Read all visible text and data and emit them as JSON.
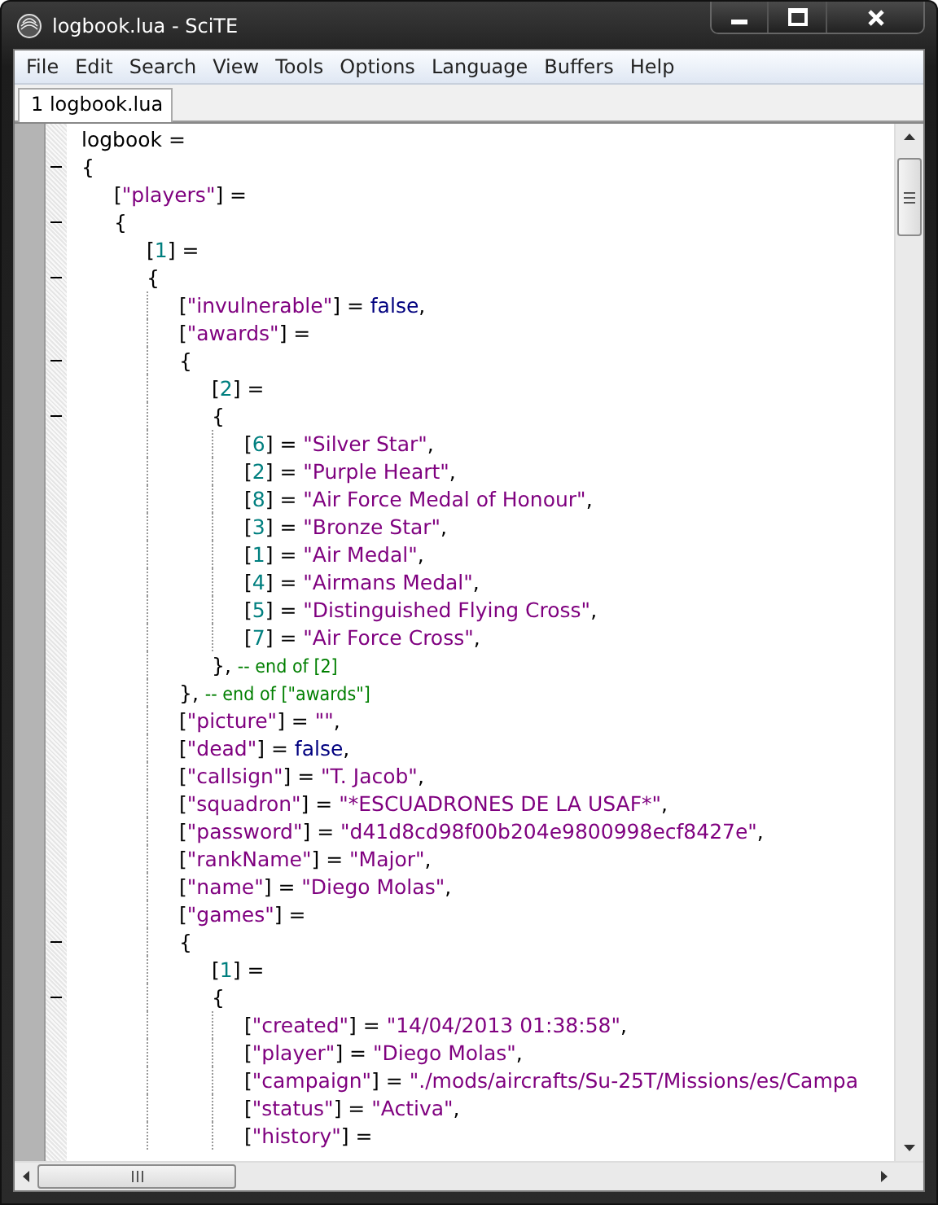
{
  "window": {
    "title": "logbook.lua - SciTE"
  },
  "menu": [
    "File",
    "Edit",
    "Search",
    "View",
    "Tools",
    "Options",
    "Language",
    "Buffers",
    "Help"
  ],
  "tabs": [
    {
      "label": "1 logbook.lua",
      "selected": true
    }
  ],
  "editor": {
    "lines": [
      {
        "tokens": [
          {
            "kind": "op",
            "text": "logbook ="
          }
        ]
      },
      {
        "tokens": [
          {
            "kind": "op",
            "text": "{"
          }
        ],
        "expanded": true,
        "children": [
          {
            "tokens": [
              {
                "kind": "op",
                "text": "["
              },
              {
                "kind": "str",
                "text": "\"players\""
              },
              {
                "kind": "op",
                "text": "] ="
              }
            ]
          },
          {
            "tokens": [
              {
                "kind": "op",
                "text": "{"
              }
            ],
            "expanded": true,
            "children": [
              {
                "tokens": [
                  {
                    "kind": "op",
                    "text": "["
                  },
                  {
                    "kind": "num",
                    "text": "1"
                  },
                  {
                    "kind": "op",
                    "text": "] ="
                  }
                ]
              },
              {
                "tokens": [
                  {
                    "kind": "op",
                    "text": "{"
                  }
                ],
                "expanded": true,
                "children": [
                  {
                    "tokens": [
                      {
                        "kind": "op",
                        "text": "["
                      },
                      {
                        "kind": "str",
                        "text": "\"invulnerable\""
                      },
                      {
                        "kind": "op",
                        "text": "] = "
                      },
                      {
                        "kind": "kw",
                        "text": "false"
                      },
                      {
                        "kind": "op",
                        "text": ","
                      }
                    ]
                  },
                  {
                    "tokens": [
                      {
                        "kind": "op",
                        "text": "["
                      },
                      {
                        "kind": "str",
                        "text": "\"awards\""
                      },
                      {
                        "kind": "op",
                        "text": "] ="
                      }
                    ]
                  },
                  {
                    "tokens": [
                      {
                        "kind": "op",
                        "text": "{"
                      }
                    ],
                    "expanded": true,
                    "children": [
                      {
                        "tokens": [
                          {
                            "kind": "op",
                            "text": "["
                          },
                          {
                            "kind": "num",
                            "text": "2"
                          },
                          {
                            "kind": "op",
                            "text": "] ="
                          }
                        ]
                      },
                      {
                        "tokens": [
                          {
                            "kind": "op",
                            "text": "{"
                          }
                        ],
                        "expanded": true,
                        "children": [
                          {
                            "tokens": [
                              {
                                "kind": "op",
                                "text": "["
                              },
                              {
                                "kind": "num",
                                "text": "6"
                              },
                              {
                                "kind": "op",
                                "text": "] = "
                              },
                              {
                                "kind": "str",
                                "text": "\"Silver Star\""
                              },
                              {
                                "kind": "op",
                                "text": ","
                              }
                            ]
                          },
                          {
                            "tokens": [
                              {
                                "kind": "op",
                                "text": "["
                              },
                              {
                                "kind": "num",
                                "text": "2"
                              },
                              {
                                "kind": "op",
                                "text": "] = "
                              },
                              {
                                "kind": "str",
                                "text": "\"Purple Heart\""
                              },
                              {
                                "kind": "op",
                                "text": ","
                              }
                            ]
                          },
                          {
                            "tokens": [
                              {
                                "kind": "op",
                                "text": "["
                              },
                              {
                                "kind": "num",
                                "text": "8"
                              },
                              {
                                "kind": "op",
                                "text": "] = "
                              },
                              {
                                "kind": "str",
                                "text": "\"Air Force Medal of Honour\""
                              },
                              {
                                "kind": "op",
                                "text": ","
                              }
                            ]
                          },
                          {
                            "tokens": [
                              {
                                "kind": "op",
                                "text": "["
                              },
                              {
                                "kind": "num",
                                "text": "3"
                              },
                              {
                                "kind": "op",
                                "text": "] = "
                              },
                              {
                                "kind": "str",
                                "text": "\"Bronze Star\""
                              },
                              {
                                "kind": "op",
                                "text": ","
                              }
                            ]
                          },
                          {
                            "tokens": [
                              {
                                "kind": "op",
                                "text": "["
                              },
                              {
                                "kind": "num",
                                "text": "1"
                              },
                              {
                                "kind": "op",
                                "text": "] = "
                              },
                              {
                                "kind": "str",
                                "text": "\"Air Medal\""
                              },
                              {
                                "kind": "op",
                                "text": ","
                              }
                            ]
                          },
                          {
                            "tokens": [
                              {
                                "kind": "op",
                                "text": "["
                              },
                              {
                                "kind": "num",
                                "text": "4"
                              },
                              {
                                "kind": "op",
                                "text": "] = "
                              },
                              {
                                "kind": "str",
                                "text": "\"Airmans Medal\""
                              },
                              {
                                "kind": "op",
                                "text": ","
                              }
                            ]
                          },
                          {
                            "tokens": [
                              {
                                "kind": "op",
                                "text": "["
                              },
                              {
                                "kind": "num",
                                "text": "5"
                              },
                              {
                                "kind": "op",
                                "text": "] = "
                              },
                              {
                                "kind": "str",
                                "text": "\"Distinguished Flying Cross\""
                              },
                              {
                                "kind": "op",
                                "text": ","
                              }
                            ]
                          },
                          {
                            "tokens": [
                              {
                                "kind": "op",
                                "text": "["
                              },
                              {
                                "kind": "num",
                                "text": "7"
                              },
                              {
                                "kind": "op",
                                "text": "] = "
                              },
                              {
                                "kind": "str",
                                "text": "\"Air Force Cross\""
                              },
                              {
                                "kind": "op",
                                "text": ","
                              }
                            ]
                          }
                        ]
                      },
                      {
                        "tokens": [
                          {
                            "kind": "op",
                            "text": "}, "
                          },
                          {
                            "kind": "cmt",
                            "text": "-- end of [2]"
                          }
                        ]
                      }
                    ]
                  },
                  {
                    "tokens": [
                      {
                        "kind": "op",
                        "text": "}, "
                      },
                      {
                        "kind": "cmt",
                        "text": "-- end of [\"awards\"]"
                      }
                    ]
                  },
                  {
                    "tokens": [
                      {
                        "kind": "op",
                        "text": "["
                      },
                      {
                        "kind": "str",
                        "text": "\"picture\""
                      },
                      {
                        "kind": "op",
                        "text": "] = "
                      },
                      {
                        "kind": "str",
                        "text": "\"\""
                      },
                      {
                        "kind": "op",
                        "text": ","
                      }
                    ]
                  },
                  {
                    "tokens": [
                      {
                        "kind": "op",
                        "text": "["
                      },
                      {
                        "kind": "str",
                        "text": "\"dead\""
                      },
                      {
                        "kind": "op",
                        "text": "] = "
                      },
                      {
                        "kind": "kw",
                        "text": "false"
                      },
                      {
                        "kind": "op",
                        "text": ","
                      }
                    ]
                  },
                  {
                    "tokens": [
                      {
                        "kind": "op",
                        "text": "["
                      },
                      {
                        "kind": "str",
                        "text": "\"callsign\""
                      },
                      {
                        "kind": "op",
                        "text": "] = "
                      },
                      {
                        "kind": "str",
                        "text": "\"T. Jacob\""
                      },
                      {
                        "kind": "op",
                        "text": ","
                      }
                    ]
                  },
                  {
                    "tokens": [
                      {
                        "kind": "op",
                        "text": "["
                      },
                      {
                        "kind": "str",
                        "text": "\"squadron\""
                      },
                      {
                        "kind": "op",
                        "text": "] = "
                      },
                      {
                        "kind": "str",
                        "text": "\"*ESCUADRONES DE LA USAF*\""
                      },
                      {
                        "kind": "op",
                        "text": ","
                      }
                    ]
                  },
                  {
                    "tokens": [
                      {
                        "kind": "op",
                        "text": "["
                      },
                      {
                        "kind": "str",
                        "text": "\"password\""
                      },
                      {
                        "kind": "op",
                        "text": "] = "
                      },
                      {
                        "kind": "str",
                        "text": "\"d41d8cd98f00b204e9800998ecf8427e\""
                      },
                      {
                        "kind": "op",
                        "text": ","
                      }
                    ]
                  },
                  {
                    "tokens": [
                      {
                        "kind": "op",
                        "text": "["
                      },
                      {
                        "kind": "str",
                        "text": "\"rankName\""
                      },
                      {
                        "kind": "op",
                        "text": "] = "
                      },
                      {
                        "kind": "str",
                        "text": "\"Major\""
                      },
                      {
                        "kind": "op",
                        "text": ","
                      }
                    ]
                  },
                  {
                    "tokens": [
                      {
                        "kind": "op",
                        "text": "["
                      },
                      {
                        "kind": "str",
                        "text": "\"name\""
                      },
                      {
                        "kind": "op",
                        "text": "] = "
                      },
                      {
                        "kind": "str",
                        "text": "\"Diego Molas\""
                      },
                      {
                        "kind": "op",
                        "text": ","
                      }
                    ]
                  },
                  {
                    "tokens": [
                      {
                        "kind": "op",
                        "text": "["
                      },
                      {
                        "kind": "str",
                        "text": "\"games\""
                      },
                      {
                        "kind": "op",
                        "text": "] ="
                      }
                    ]
                  },
                  {
                    "tokens": [
                      {
                        "kind": "op",
                        "text": "{"
                      }
                    ],
                    "expanded": true,
                    "children": [
                      {
                        "tokens": [
                          {
                            "kind": "op",
                            "text": "["
                          },
                          {
                            "kind": "num",
                            "text": "1"
                          },
                          {
                            "kind": "op",
                            "text": "] ="
                          }
                        ]
                      },
                      {
                        "tokens": [
                          {
                            "kind": "op",
                            "text": "{"
                          }
                        ],
                        "expanded": true,
                        "children": [
                          {
                            "tokens": [
                              {
                                "kind": "op",
                                "text": "["
                              },
                              {
                                "kind": "str",
                                "text": "\"created\""
                              },
                              {
                                "kind": "op",
                                "text": "] = "
                              },
                              {
                                "kind": "str",
                                "text": "\"14/04/2013 01:38:58\""
                              },
                              {
                                "kind": "op",
                                "text": ","
                              }
                            ]
                          },
                          {
                            "tokens": [
                              {
                                "kind": "op",
                                "text": "["
                              },
                              {
                                "kind": "str",
                                "text": "\"player\""
                              },
                              {
                                "kind": "op",
                                "text": "] = "
                              },
                              {
                                "kind": "str",
                                "text": "\"Diego Molas\""
                              },
                              {
                                "kind": "op",
                                "text": ","
                              }
                            ]
                          },
                          {
                            "tokens": [
                              {
                                "kind": "op",
                                "text": "["
                              },
                              {
                                "kind": "str",
                                "text": "\"campaign\""
                              },
                              {
                                "kind": "op",
                                "text": "] = "
                              },
                              {
                                "kind": "str",
                                "text": "\"./mods/aircrafts/Su-25T/Missions/es/Campa"
                              }
                            ]
                          },
                          {
                            "tokens": [
                              {
                                "kind": "op",
                                "text": "["
                              },
                              {
                                "kind": "str",
                                "text": "\"status\""
                              },
                              {
                                "kind": "op",
                                "text": "] = "
                              },
                              {
                                "kind": "str",
                                "text": "\"Activa\""
                              },
                              {
                                "kind": "op",
                                "text": ","
                              }
                            ]
                          },
                          {
                            "tokens": [
                              {
                                "kind": "op",
                                "text": "["
                              },
                              {
                                "kind": "str",
                                "text": "\"history\""
                              },
                              {
                                "kind": "op",
                                "text": "] ="
                              }
                            ]
                          }
                        ]
                      }
                    ]
                  }
                ]
              }
            ]
          }
        ]
      }
    ]
  }
}
